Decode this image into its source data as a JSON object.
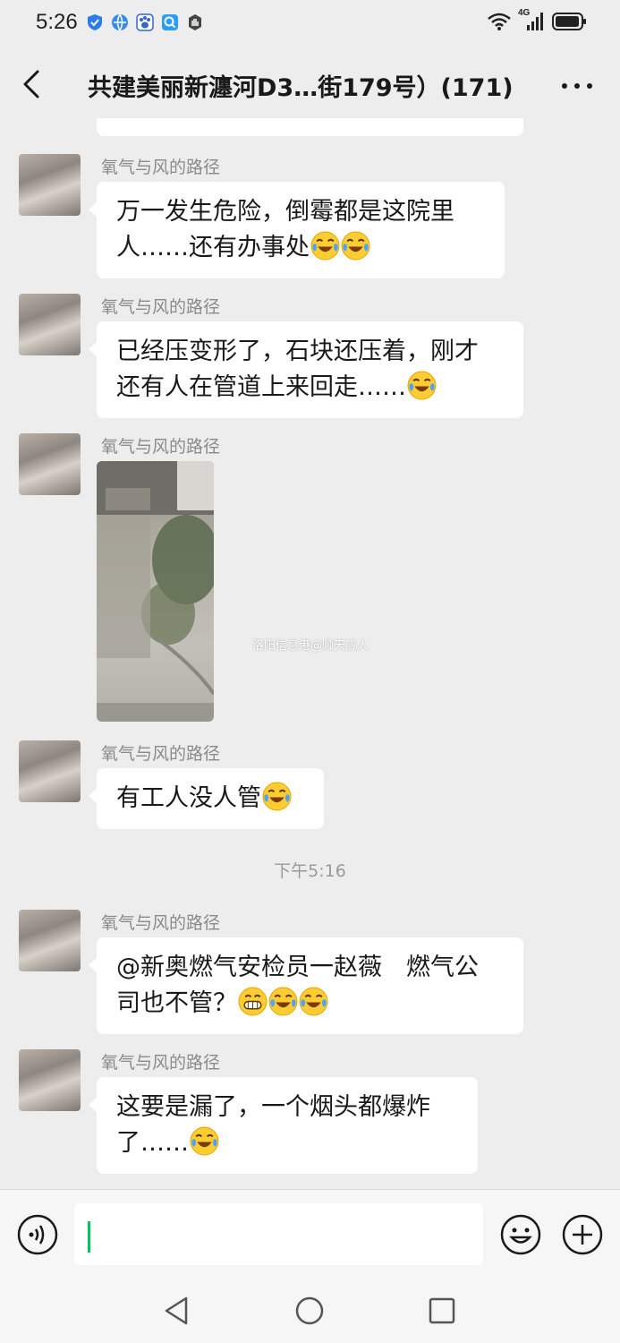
{
  "status_bar": {
    "time": "5:26",
    "network_label": "4G",
    "notification_icons": [
      "shield-icon",
      "browser-icon",
      "baidu-icon",
      "search-app-icon",
      "hand-icon"
    ]
  },
  "header": {
    "title": "共建美丽新瀍河D3…街179号）(171)"
  },
  "messages": [
    {
      "sender": "氧气与风的路径",
      "line1": "万一发生危险，倒霉都是这院里",
      "line2": "人……还有办事处"
    },
    {
      "sender": "氧气与风的路径",
      "line1": "已经压变形了，石块还压着，刚才",
      "line2": "还有人在管道上来回走……"
    },
    {
      "sender": "氧气与风的路径",
      "watermark": "洛阳信息港@顺天应人"
    },
    {
      "sender": "氧气与风的路径",
      "line1": "有工人没人管"
    },
    {
      "sender": "氧气与风的路径",
      "line1": "@新奥燃气安检员一赵薇　燃气公",
      "line2": "司也不管？"
    },
    {
      "sender": "氧气与风的路径",
      "line1": "这要是漏了，一个烟头都爆炸",
      "line2": "了……"
    }
  ],
  "time_divider": "下午5:16",
  "colors": {
    "background": "#ededed",
    "bubble": "#ffffff",
    "accent": "#07c160",
    "sender_name": "#8a8a8a"
  }
}
